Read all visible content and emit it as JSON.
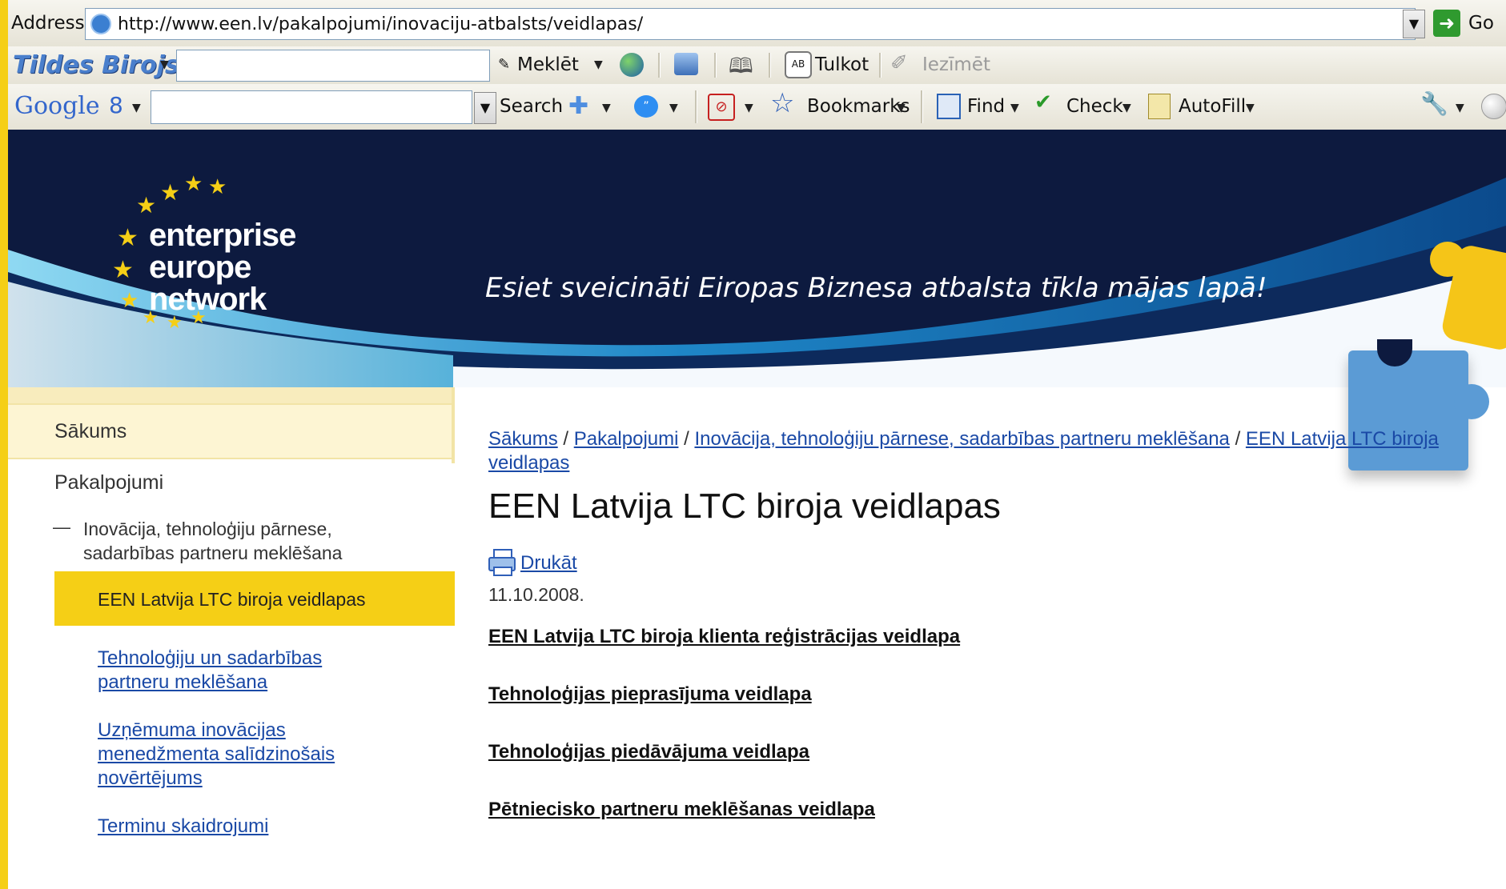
{
  "browser": {
    "address_label": "Address",
    "url": "http://www.een.lv/pakalpojumi/inovaciju-atbalsts/veidlapas/",
    "go_label": "Go"
  },
  "tildes_toolbar": {
    "logo": "Tildes Birojs",
    "meklet": "Meklēt",
    "tulkot": "Tulkot",
    "iezimet": "Iezīmēt"
  },
  "google_toolbar": {
    "logo": "Google",
    "search": "Search",
    "bookmarks": "Bookmarks",
    "find": "Find",
    "check": "Check",
    "autofill": "AutoFill"
  },
  "banner": {
    "logo_line1": "enterprise",
    "logo_line2": "europe",
    "logo_line3": "network",
    "welcome": "Esiet sveicināti Eiropas Biznesa atbalsta tīkla mājas lapā!"
  },
  "nav": {
    "home": "Sākums",
    "services": "Pakalpojumi",
    "dash": "—",
    "innovation_line1": "Inovācija, tehnoloģiju pārnese,",
    "innovation_line2": "sadarbības partneru meklēšana",
    "active": "EEN Latvija LTC biroja veidlapas",
    "sub1_line1": "Tehnoloģiju un sadarbības",
    "sub1_line2": "partneru meklēšana",
    "sub2_line1": "Uzņēmuma inovācijas",
    "sub2_line2": "menedžmenta salīdzinošais",
    "sub2_line3": "novērtējums",
    "sub3": "Terminu skaidrojumi"
  },
  "breadcrumb": {
    "items": [
      "Sākums",
      "Pakalpojumi",
      "Inovācija, tehnoloģiju pārnese, sadarbības partneru meklēšana",
      "EEN Latvija LTC biroja"
    ],
    "last_cont": "veidlapas",
    "sep": "/"
  },
  "content": {
    "title": "EEN Latvija LTC biroja veidlapas",
    "print": "Drukāt",
    "date": "11.10.2008.",
    "links": [
      "EEN Latvija LTC biroja klienta reģistrācijas veidlapa",
      "Tehnoloģijas pieprasījuma veidlapa",
      "Tehnoloģijas piedāvājuma veidlapa",
      "Pētniecisko partneru meklēšanas veidlapa"
    ]
  },
  "colors": {
    "accent_yellow": "#f5cf16",
    "banner_navy": "#0d1a3f",
    "link_blue": "#1a49a6"
  }
}
